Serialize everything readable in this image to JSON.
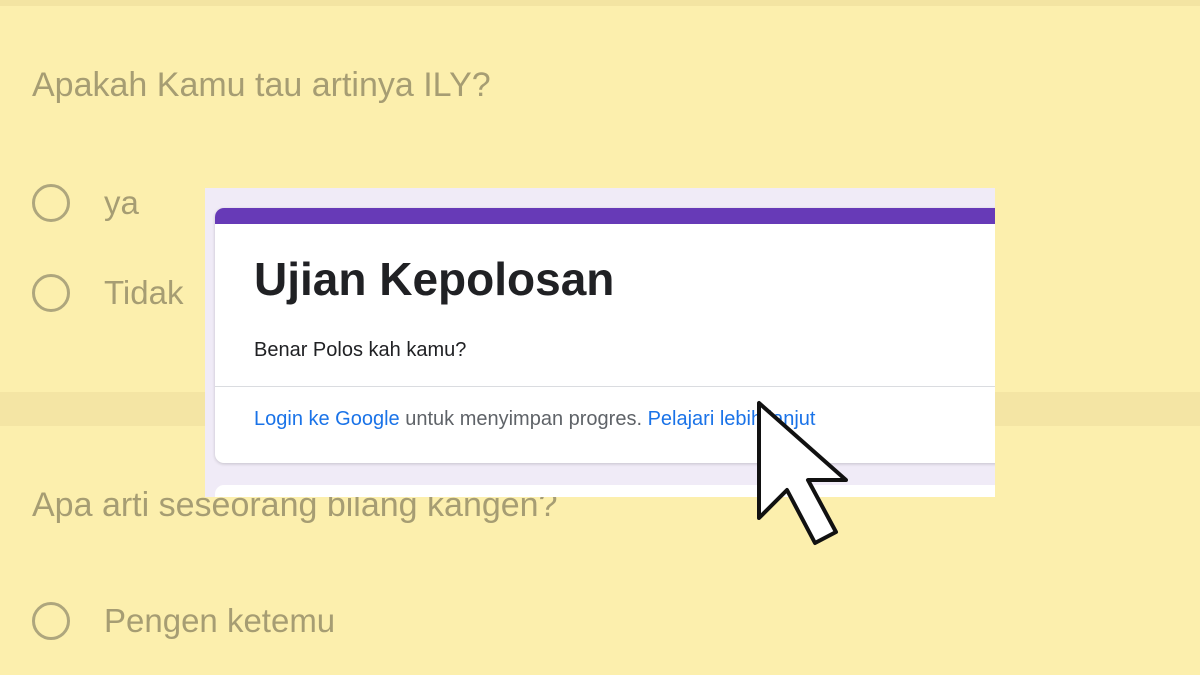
{
  "questions": [
    {
      "text": "Apakah Kamu tau artinya ILY?",
      "options": [
        "ya",
        "Tidak"
      ]
    },
    {
      "text": "Apa arti seseorang bilang kangen?",
      "options": [
        "Pengen ketemu"
      ]
    }
  ],
  "form": {
    "title": "Ujian Kepolosan",
    "description": "Benar Polos kah kamu?",
    "login_link": "Login ke Google",
    "login_text": " untuk menyimpan progres. ",
    "learn_more_link": "Pelajari lebih lanjut",
    "accent_color": "#673ab7"
  },
  "icons": {
    "cursor": "mouse-pointer-icon",
    "radio": "radio-button-icon"
  }
}
